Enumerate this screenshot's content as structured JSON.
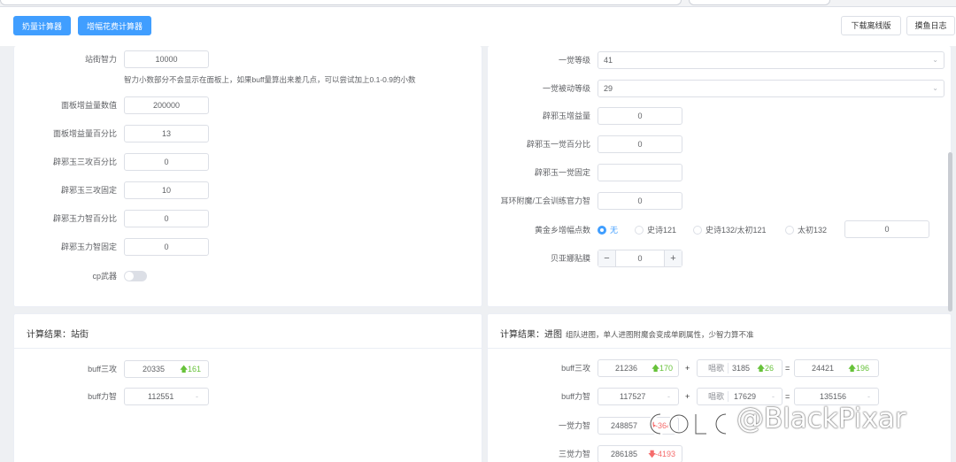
{
  "toolbar": {
    "naizhao_calc": "奶量计算器",
    "zengfu_calc": "增幅花费计算器",
    "download_offline": "下载离线版",
    "moyu_log": "摸鱼日志"
  },
  "left_form": {
    "zhanjie_zhili": {
      "label": "站街智力",
      "value": "10000"
    },
    "hint": "智力小数部分不会显示在面板上，如果buff量算出来差几点，可以尝试加上0.1-0.9的小数",
    "mianban_shuzhi": {
      "label": "面板增益量数值",
      "value": "200000"
    },
    "mianban_bfb": {
      "label": "面板增益量百分比",
      "value": "13"
    },
    "bxy_sangong_bfb": {
      "label": "辟邪玉三攻百分比",
      "value": "0"
    },
    "bxy_sangong_gd": {
      "label": "辟邪玉三攻固定",
      "value": "10"
    },
    "bxy_lizhi_bfb": {
      "label": "辟邪玉力智百分比",
      "value": "0"
    },
    "bxy_lizhi_gd": {
      "label": "辟邪玉力智固定",
      "value": "0"
    },
    "cp_weapon": {
      "label": "cp武器"
    }
  },
  "right_form": {
    "yijue_level": {
      "label": "一觉等级",
      "value": "41"
    },
    "yijue_beidong": {
      "label": "一觉被动等级",
      "value": "29"
    },
    "bxy_zengyi": {
      "label": "辟邪玉增益量",
      "value": "0"
    },
    "bxy_yijue_bfb": {
      "label": "辟邪玉一觉百分比",
      "value": "0"
    },
    "bxy_yijue_gd": {
      "label": "辟邪玉一觉固定",
      "value": ""
    },
    "erhuan": {
      "label": "耳环附魔/工会训练官力智",
      "value": "0"
    },
    "huangjin": {
      "label": "黄金乡增幅点数",
      "options": [
        "无",
        "史诗121",
        "史诗132/太初121",
        "太初132"
      ],
      "selected": 0,
      "value": "0"
    },
    "beiya": {
      "label": "贝亚娜贴膜",
      "value": "0",
      "minus": "−",
      "plus": "+"
    }
  },
  "result_left": {
    "title": "计算结果：站街",
    "buff_sangong": {
      "label": "buff三攻",
      "value": "20335",
      "delta": "161"
    },
    "buff_lizhi": {
      "label": "buff力智",
      "value": "112551",
      "delta": "-"
    }
  },
  "result_right": {
    "title": "计算结果：进图",
    "note": "组队进图，单人进图附魔会变成单刷属性，少智力算不准",
    "buff_sangong": {
      "label": "buff三攻",
      "base": "21236",
      "base_delta": "170",
      "plus": "+",
      "song_label": "唱歌",
      "song": "3185",
      "song_delta": "26",
      "eq": "=",
      "total": "24421",
      "total_delta": "196"
    },
    "buff_lizhi": {
      "label": "buff力智",
      "base": "117527",
      "base_delta": "-",
      "plus": "+",
      "song_label": "唱歌",
      "song": "17629",
      "song_delta": "-",
      "eq": "=",
      "total": "135156",
      "total_delta": "-"
    },
    "yijue_lizhi": {
      "label": "一觉力智",
      "value": "248857",
      "delta": "-364"
    },
    "sanjue_lizhi": {
      "label": "三觉力智",
      "value": "286185",
      "delta": "-4193"
    }
  },
  "watermark": "@BlackPixar",
  "colors": {
    "primary": "#409eff",
    "up": "#67c23a",
    "down": "#f56c6c"
  }
}
